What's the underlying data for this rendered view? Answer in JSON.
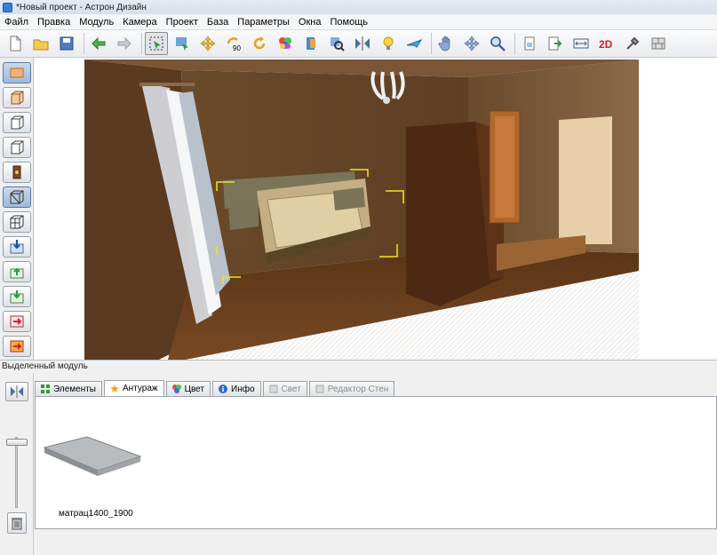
{
  "window": {
    "title": "*Новый проект - Астрон Дизайн"
  },
  "menu": {
    "items": [
      "Файл",
      "Правка",
      "Модуль",
      "Камера",
      "Проект",
      "База",
      "Параметры",
      "Окна",
      "Помощь"
    ]
  },
  "toolbar": {
    "icons": [
      "new-file-icon",
      "open-folder-icon",
      "save-icon",
      "undo-icon",
      "redo-icon",
      "select-frame-icon",
      "move-select-icon",
      "move-arrows-icon",
      "rotate-90-icon",
      "rotate-icon",
      "color-palette-icon",
      "door-module-icon",
      "zoom-module-icon",
      "mirror-icon",
      "light-bulb-icon",
      "airplane-icon",
      "hand-pan-icon",
      "move-cross-icon",
      "zoom-icon",
      "document-icon",
      "export-icon",
      "width-icon",
      "2d-view-icon",
      "tools-icon",
      "wall-icon"
    ],
    "rotate_label": "90",
    "view_2d_label": "2D"
  },
  "left_tools": {
    "icons": [
      "floor-view-icon",
      "box-front-icon",
      "box-wire-icon",
      "box-side-icon",
      "box-dark-icon",
      "box-perspective-icon",
      "box-grid-icon",
      "import-down-icon",
      "import-up-icon",
      "import-green-icon",
      "export-red-icon",
      "panel-red-icon"
    ]
  },
  "status": {
    "text": "Выделенный модуль"
  },
  "tabs": [
    {
      "label": "Элементы",
      "icon": "grid-green-icon",
      "state": "normal"
    },
    {
      "label": "Антураж",
      "icon": "star-icon",
      "state": "active"
    },
    {
      "label": "Цвет",
      "icon": "color-icon",
      "state": "normal"
    },
    {
      "label": "Инфо",
      "icon": "info-icon",
      "state": "normal"
    },
    {
      "label": "Свет",
      "icon": "light-icon",
      "state": "disabled"
    },
    {
      "label": "Редактор Стен",
      "icon": "wall-editor-icon",
      "state": "disabled"
    }
  ],
  "panel": {
    "module_caption": "матрац1400_1900"
  },
  "colors": {
    "wall_brown": "#6b4a2b",
    "floor_wood": "#6a3f1d",
    "selection_yellow": "#f2e51a"
  }
}
